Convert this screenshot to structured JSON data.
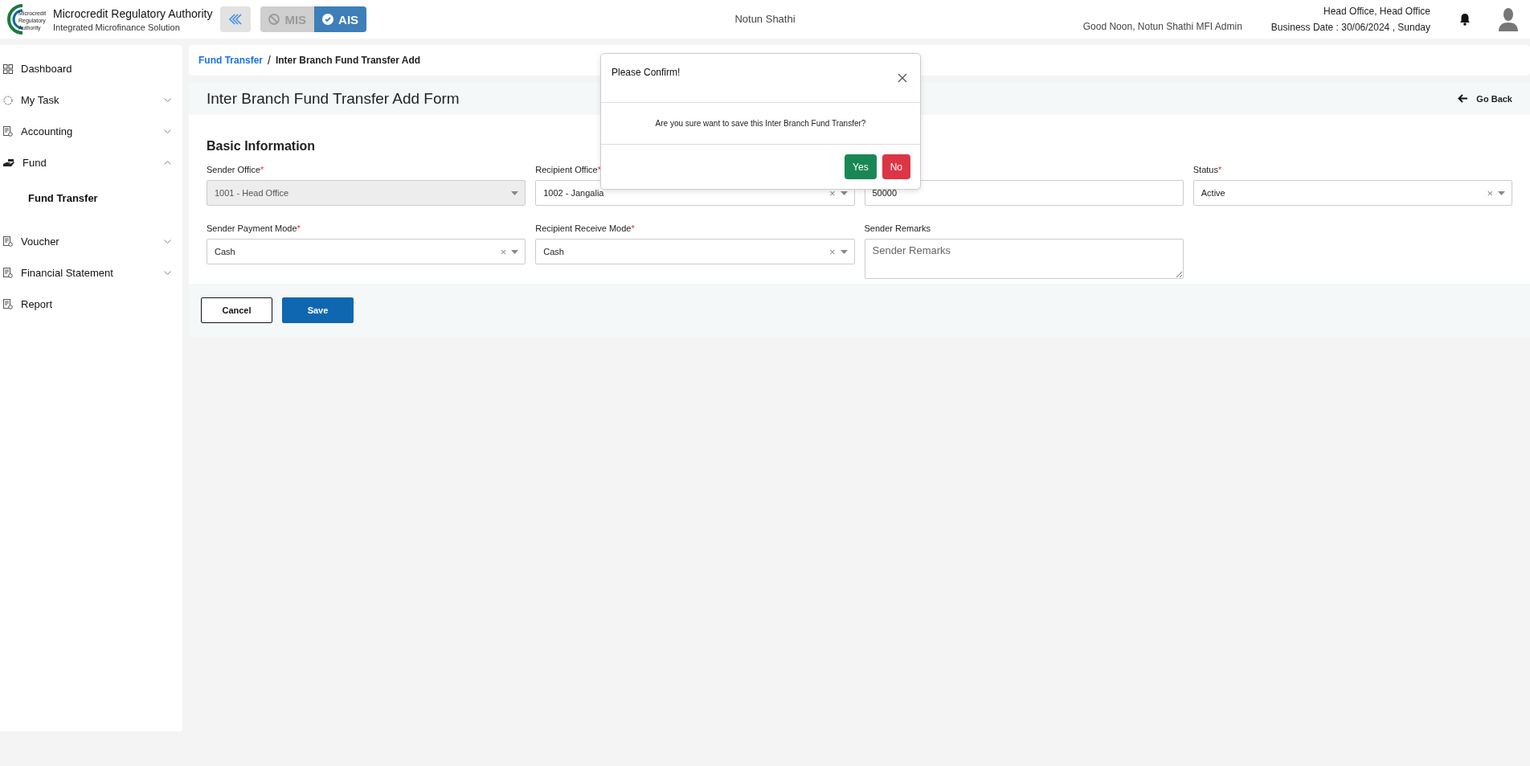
{
  "header": {
    "brand_title": "Microcredit Regulatory Authority",
    "brand_subtitle": "Integrated Microfinance Solution",
    "logo_text": [
      "Microcredit",
      "Regulatory",
      "Authority"
    ],
    "modes": [
      {
        "label": "MIS",
        "selected": false
      },
      {
        "label": "AIS",
        "selected": true
      }
    ],
    "organization": "Notun Shathi",
    "greeting": "Good Noon, Notun Shathi MFI Admin",
    "office": "Head Office, Head Office",
    "business_date": "Business Date : 30/06/2024 , Sunday"
  },
  "sidebar": {
    "items": [
      {
        "label": "Dashboard",
        "kind": "grid"
      },
      {
        "label": "My Task",
        "kind": "task",
        "expanded": false
      },
      {
        "label": "Accounting",
        "kind": "doc",
        "expanded": false
      },
      {
        "label": "Fund",
        "kind": "fund",
        "expanded": true,
        "children": [
          {
            "label": "Fund Transfer"
          }
        ]
      },
      {
        "label": "Voucher",
        "kind": "doc",
        "expanded": false
      },
      {
        "label": "Financial Statement",
        "kind": "doc",
        "expanded": false
      },
      {
        "label": "Report",
        "kind": "doc"
      }
    ]
  },
  "breadcrumb": [
    {
      "label": "Fund Transfer",
      "kind": "link"
    },
    {
      "label": "/",
      "kind": "separator"
    },
    {
      "label": "Inter Branch Fund Transfer Add",
      "kind": "current"
    }
  ],
  "form": {
    "title": "Inter Branch Fund Transfer Add Form",
    "back": "Go Back",
    "section": "Basic Information",
    "fields": [
      {
        "kind": "select",
        "label": "Sender Office",
        "required_mark": "*",
        "value": "1001 - Head Office",
        "disabled": true
      },
      {
        "kind": "select",
        "label": "Recipient Office",
        "required_mark": "*",
        "value": "1002 - Jangalia",
        "disabled": false,
        "clear": "×"
      },
      {
        "kind": "input",
        "value": "50000"
      },
      {
        "kind": "select",
        "label": "Status",
        "required_mark": "*",
        "value": "Active",
        "disabled": false,
        "clear": "×"
      },
      {
        "kind": "select",
        "label": "Sender Payment Mode",
        "required_mark": "*",
        "value": "Cash",
        "disabled": false,
        "clear": "×"
      },
      {
        "kind": "select",
        "label": "Recipient Receive Mode",
        "required_mark": "*",
        "value": "Cash",
        "disabled": false,
        "clear": "×"
      },
      {
        "kind": "textarea",
        "label": "Sender Remarks",
        "placeholder": "Sender Remarks"
      }
    ],
    "buttons": [
      {
        "label": "Cancel",
        "kind": "outline"
      },
      {
        "label": "Save",
        "kind": "primary"
      }
    ]
  },
  "dialog": {
    "title": "Please Confirm!",
    "message": "Are you sure want to save this Inter Branch Fund Transfer?",
    "buttons": [
      {
        "label": "Yes",
        "kind": "success"
      },
      {
        "label": "No",
        "kind": "danger"
      }
    ]
  }
}
